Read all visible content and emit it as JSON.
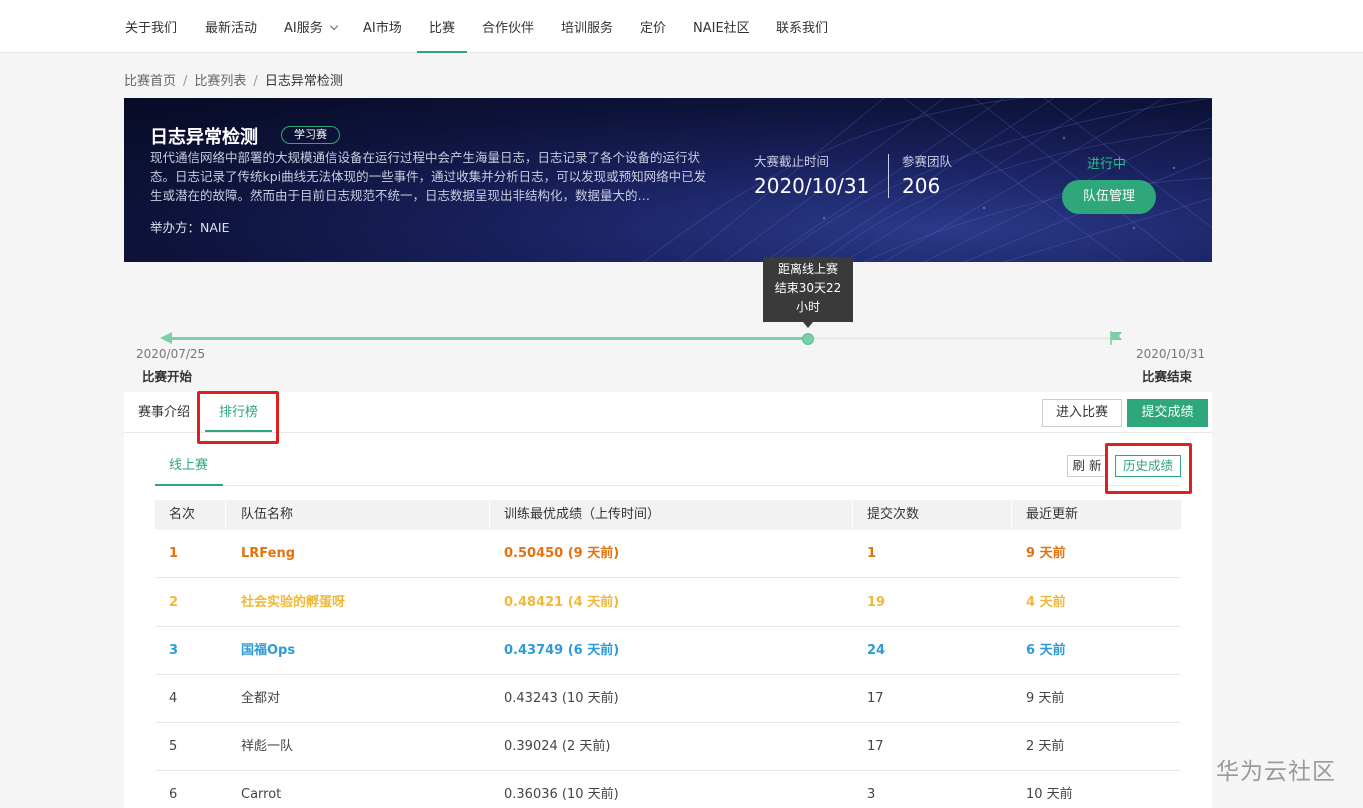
{
  "nav": {
    "items": [
      {
        "label": "关于我们"
      },
      {
        "label": "最新活动"
      },
      {
        "label": "AI服务"
      },
      {
        "label": "AI市场"
      },
      {
        "label": "比赛"
      },
      {
        "label": "合作伙伴"
      },
      {
        "label": "培训服务"
      },
      {
        "label": "定价"
      },
      {
        "label": "NAIE社区"
      },
      {
        "label": "联系我们"
      }
    ],
    "active": "比赛"
  },
  "breadcrumb": {
    "home": "比赛首页",
    "list": "比赛列表",
    "current": "日志异常检测",
    "separator": "/"
  },
  "banner": {
    "title": "日志异常检测",
    "tag": "学习赛",
    "description": "现代通信网络中部署的大规模通信设备在运行过程中会产生海量日志，日志记录了各个设备的运行状态。日志记录了传统kpi曲线无法体现的一些事件，通过收集并分析日志，可以发现或预知网络中已发生或潜在的故障。然而由于目前日志规范不统一，日志数据呈现出非结构化，数据量大的…",
    "organizer": "举办方：NAIE",
    "deadline_label": "大赛截止时间",
    "deadline_value": "2020/10/31",
    "teams_label": "参赛团队",
    "teams_value": "206",
    "status": "进行中",
    "team_button": "队伍管理",
    "accent": "#2ea77a"
  },
  "timeline": {
    "tooltip_line1": "距离线上赛",
    "tooltip_line2": "结束30天22",
    "tooltip_line3": "小时",
    "start_date": "2020/07/25",
    "start_label": "比赛开始",
    "end_date": "2020/10/31",
    "end_label": "比赛结束",
    "progress_fraction": 0.68
  },
  "tabs": {
    "intro": "赛事介绍",
    "leaderboard": "排行榜",
    "enter_button": "进入比赛",
    "submit_button": "提交成绩"
  },
  "subtabs": {
    "online": "线上赛",
    "refresh_button": "刷 新",
    "history_button": "历史成绩"
  },
  "table": {
    "headers": [
      "名次",
      "队伍名称",
      "训练最优成绩（上传时间）",
      "提交次数",
      "最近更新"
    ],
    "rows": [
      {
        "rank": "1",
        "team": "LRFeng",
        "score": "0.50450 (9 天前)",
        "submissions": "1",
        "updated": "9 天前"
      },
      {
        "rank": "2",
        "team": "社会实验的孵蛋呀",
        "score": "0.48421 (4 天前)",
        "submissions": "19",
        "updated": "4 天前"
      },
      {
        "rank": "3",
        "team": "国福Ops",
        "score": "0.43749 (6 天前)",
        "submissions": "24",
        "updated": "6 天前"
      },
      {
        "rank": "4",
        "team": "全都对",
        "score": "0.43243 (10 天前)",
        "submissions": "17",
        "updated": "9 天前"
      },
      {
        "rank": "5",
        "team": "祥彪一队",
        "score": "0.39024 (2 天前)",
        "submissions": "17",
        "updated": "2 天前"
      },
      {
        "rank": "6",
        "team": "Carrot",
        "score": "0.36036 (10 天前)",
        "submissions": "3",
        "updated": "10 天前"
      }
    ],
    "colors": {
      "first": "#e5720e",
      "second": "#f0b83a",
      "third": "#2f9bd6"
    }
  },
  "watermark": "华为云社区"
}
